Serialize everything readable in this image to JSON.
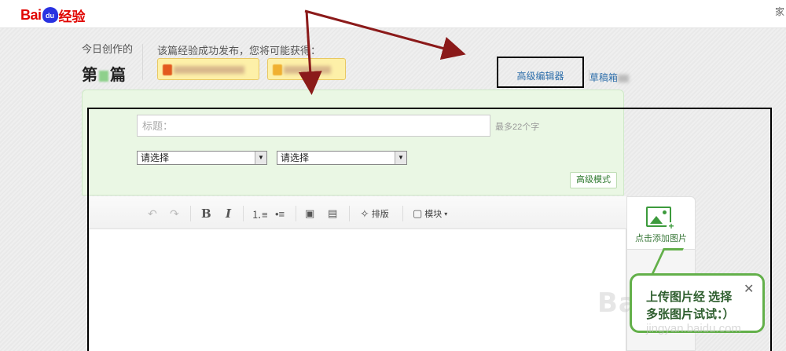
{
  "brand": {
    "logo_text_bai": "Bai",
    "logo_text_du": "du",
    "logo_text_jingyan": "经验",
    "topbar_edge_text": "家"
  },
  "header": {
    "today_label": "今日创作的",
    "today_count_prefix": "第",
    "today_count_suffix": "篇",
    "reward_text": "该篇经验成功发布，您将可能获得："
  },
  "tabs": {
    "advanced_editor": "高级编辑器",
    "drafts": "草稿箱"
  },
  "form": {
    "title_placeholder": "标题：",
    "title_hint": "最多22个字",
    "category_select_1": "请选择",
    "category_select_2": "请选择",
    "advanced_mode_button": "高级模式"
  },
  "toolbar": {
    "undo_icon": "undo-icon",
    "redo_icon": "redo-icon",
    "bold": "B",
    "italic": "I",
    "layout_label": "排版",
    "module_label": "模块"
  },
  "side_panel": {
    "upload_label": "点击添加图片"
  },
  "tooltip": {
    "text_line1": "上传图片经 选择",
    "text_line2": "多张图片试试：）",
    "close": "✕"
  },
  "watermark": {
    "main": "Bai经验",
    "url": "jingyan.baidu.com"
  },
  "colors": {
    "accent_green": "#63b04a",
    "link_blue": "#2d6eaa",
    "brand_red": "#e10602",
    "annotation_red": "#8b1a1a"
  }
}
